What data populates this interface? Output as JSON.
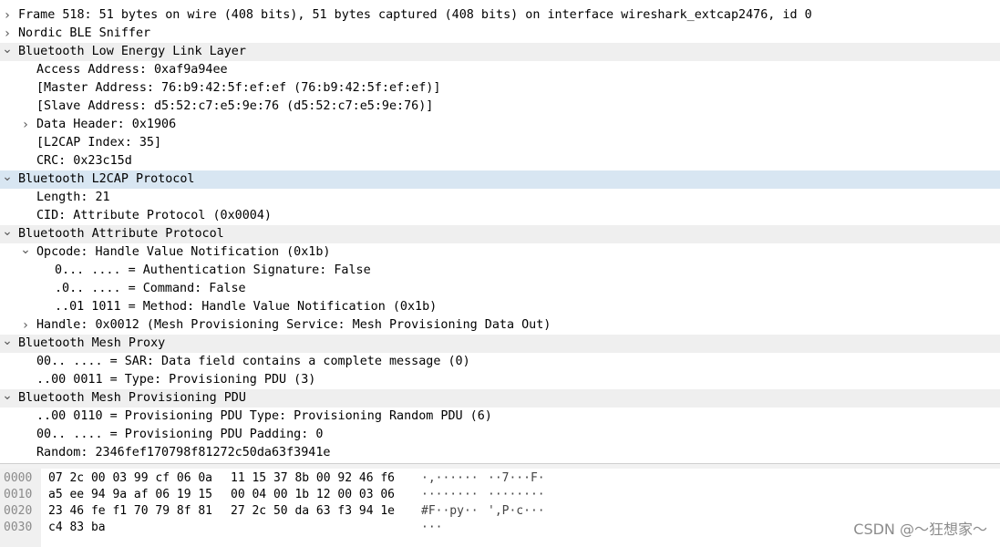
{
  "tree": [
    {
      "text": "Frame 518: 51 bytes on wire (408 bits), 51 bytes captured (408 bits) on interface wireshark_extcap2476, id 0",
      "level": 0,
      "toggle": "collapsed",
      "style": "plain"
    },
    {
      "text": "Nordic BLE Sniffer",
      "level": 0,
      "toggle": "collapsed",
      "style": "plain"
    },
    {
      "text": "Bluetooth Low Energy Link Layer",
      "level": 0,
      "toggle": "expanded",
      "style": "header"
    },
    {
      "text": "Access Address: 0xaf9a94ee",
      "level": 1,
      "toggle": "none",
      "style": "plain"
    },
    {
      "text": "[Master Address: 76:b9:42:5f:ef:ef (76:b9:42:5f:ef:ef)]",
      "level": 1,
      "toggle": "none",
      "style": "plain"
    },
    {
      "text": "[Slave Address: d5:52:c7:e5:9e:76 (d5:52:c7:e5:9e:76)]",
      "level": 1,
      "toggle": "none",
      "style": "plain"
    },
    {
      "text": "Data Header: 0x1906",
      "level": 1,
      "toggle": "collapsed",
      "style": "plain"
    },
    {
      "text": "[L2CAP Index: 35]",
      "level": 1,
      "toggle": "none",
      "style": "plain"
    },
    {
      "text": "CRC: 0x23c15d",
      "level": 1,
      "toggle": "none",
      "style": "plain"
    },
    {
      "text": "Bluetooth L2CAP Protocol",
      "level": 0,
      "toggle": "expanded",
      "style": "selected"
    },
    {
      "text": "Length: 21",
      "level": 1,
      "toggle": "none",
      "style": "plain"
    },
    {
      "text": "CID: Attribute Protocol (0x0004)",
      "level": 1,
      "toggle": "none",
      "style": "plain"
    },
    {
      "text": "Bluetooth Attribute Protocol",
      "level": 0,
      "toggle": "expanded",
      "style": "header"
    },
    {
      "text": "Opcode: Handle Value Notification (0x1b)",
      "level": 1,
      "toggle": "expanded",
      "style": "plain"
    },
    {
      "text": "0... .... = Authentication Signature: False",
      "level": 2,
      "toggle": "none",
      "style": "plain"
    },
    {
      "text": ".0.. .... = Command: False",
      "level": 2,
      "toggle": "none",
      "style": "plain"
    },
    {
      "text": "..01 1011 = Method: Handle Value Notification (0x1b)",
      "level": 2,
      "toggle": "none",
      "style": "plain"
    },
    {
      "text": "Handle: 0x0012 (Mesh Provisioning Service: Mesh Provisioning Data Out)",
      "level": 1,
      "toggle": "collapsed",
      "style": "plain"
    },
    {
      "text": "Bluetooth Mesh Proxy",
      "level": 0,
      "toggle": "expanded",
      "style": "header"
    },
    {
      "text": "00.. .... = SAR: Data field contains a complete message (0)",
      "level": 1,
      "toggle": "none",
      "style": "plain"
    },
    {
      "text": "..00 0011 = Type: Provisioning PDU (3)",
      "level": 1,
      "toggle": "none",
      "style": "plain"
    },
    {
      "text": "Bluetooth Mesh Provisioning PDU",
      "level": 0,
      "toggle": "expanded",
      "style": "header"
    },
    {
      "text": "..00 0110 = Provisioning PDU Type: Provisioning Random PDU (6)",
      "level": 1,
      "toggle": "none",
      "style": "plain"
    },
    {
      "text": "00.. .... = Provisioning PDU Padding: 0",
      "level": 1,
      "toggle": "none",
      "style": "plain"
    },
    {
      "text": "Random: 2346fef170798f81272c50da63f3941e",
      "level": 1,
      "toggle": "none",
      "style": "plain"
    }
  ],
  "hex": [
    {
      "offset": "0000",
      "bytes1": "07 2c 00 03 99 cf 06 0a",
      "bytes2": "11 15 37 8b 00 92 46 f6",
      "ascii1": "·,······",
      "ascii2": "··7···F·"
    },
    {
      "offset": "0010",
      "bytes1": "a5 ee 94 9a af 06 19 15",
      "bytes2": "00 04 00 1b 12 00 03 06",
      "ascii1": "········",
      "ascii2": "········"
    },
    {
      "offset": "0020",
      "bytes1": "23 46 fe f1 70 79 8f 81",
      "bytes2": "27 2c 50 da 63 f3 94 1e",
      "ascii1": "#F··py··",
      "ascii2": "',P·c···"
    },
    {
      "offset": "0030",
      "bytes1": "c4 83 ba",
      "bytes2": "",
      "ascii1": "···",
      "ascii2": ""
    }
  ],
  "watermark": "CSDN @～狂想家～"
}
